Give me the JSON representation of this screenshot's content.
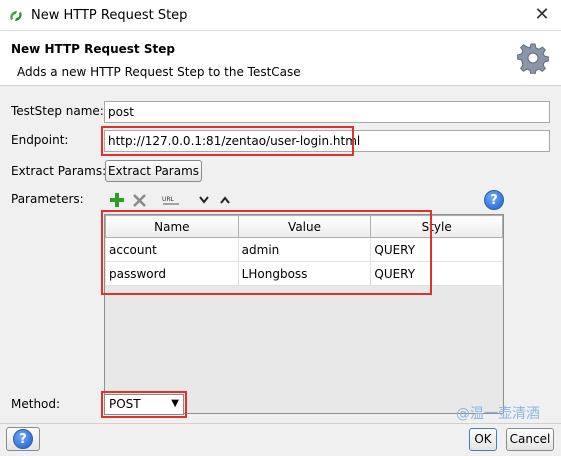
{
  "window": {
    "title": "New HTTP Request Step"
  },
  "header": {
    "title": "New HTTP Request Step",
    "description": "Adds a new HTTP Request Step to the TestCase"
  },
  "form": {
    "teststep_name_label": "TestStep name:",
    "teststep_name_value": "post",
    "endpoint_label": "Endpoint:",
    "endpoint_value": "http://127.0.0.1:81/zentao/user-login.html",
    "extract_params_label": "Extract Params:",
    "extract_params_button": "Extract Params",
    "parameters_label": "Parameters:",
    "method_label": "Method:",
    "method_value": "POST"
  },
  "toolbar": {
    "icons": [
      "add-icon",
      "remove-icon",
      "url-icon",
      "move-down-icon",
      "move-up-icon"
    ]
  },
  "parameters_table": {
    "columns": [
      "Name",
      "Value",
      "Style"
    ],
    "rows": [
      {
        "name": "account",
        "value": "admin",
        "style": "QUERY"
      },
      {
        "name": "password",
        "value": "LHongboss",
        "style": "QUERY"
      }
    ]
  },
  "watermark": "@温一壶清酒",
  "footer": {
    "ok_label": "OK",
    "cancel_label": "Cancel"
  },
  "colors": {
    "highlight": "#e03030",
    "help": "#1c5fc9",
    "add": "#2aa02a"
  }
}
